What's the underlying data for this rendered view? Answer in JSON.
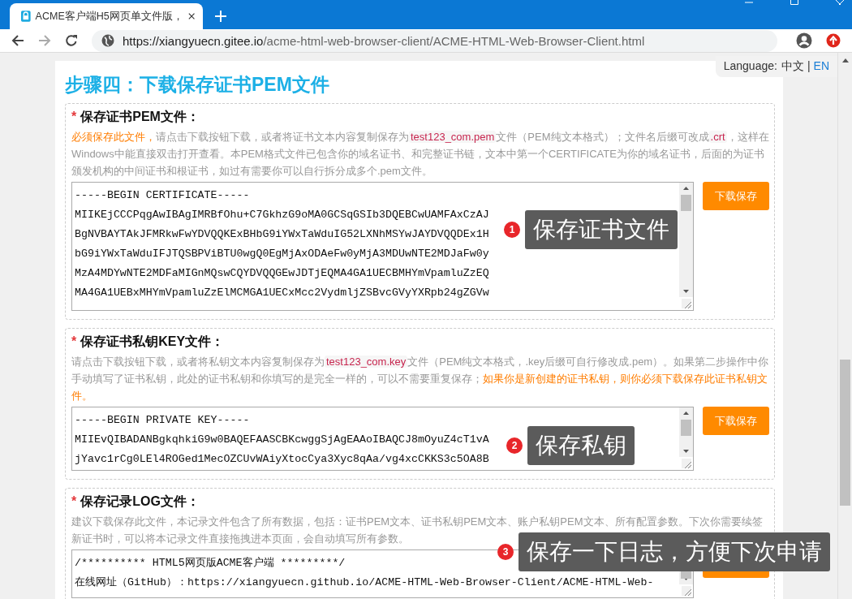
{
  "browser": {
    "tab_title": "ACME客户端H5网页单文件版，",
    "url_host": "https://xiangyuecn.gitee.io",
    "url_path": "/acme-html-web-browser-client/ACME-HTML-Web-Browser-Client.html"
  },
  "language": {
    "label": "Language:",
    "separator": "|",
    "options": [
      {
        "label": "中文",
        "selected": true
      },
      {
        "label": "EN",
        "selected": false
      }
    ]
  },
  "heading": "步骤四：下载保存证书PEM文件",
  "sections": [
    {
      "required_mark": "*",
      "title": "保存证书PEM文件：",
      "description": [
        {
          "kind": "highlight",
          "text": "必须保存此文件，"
        },
        {
          "kind": "text",
          "text": "请点击下载按钮下载，或者将证书文本内容复制保存为"
        },
        {
          "kind": "code",
          "text": "test123_com.pem"
        },
        {
          "kind": "text",
          "text": "文件（PEM纯文本格式）；文件名后缀可改成"
        },
        {
          "kind": "code",
          "text": ".crt"
        },
        {
          "kind": "text",
          "text": "，这样在Windows中能直接双击打开查看。本PEM格式文件已包含你的域名证书、和完整证书链，文本中第一个CERTIFICATE为你的域名证书，后面的为证书颁发机构的中间证书和根证书，如过有需要你可以自行拆分成多个.pem文件。"
        }
      ],
      "code_lines": [
        "-----BEGIN CERTIFICATE-----",
        "MIIKEjCCCPqgAwIBAgIMRBfOhu+C7GkhzG9oMA0GCSqGSIb3DQEBCwUAMFAxCzAJ",
        "BgNVBAYTAkJFMRkwFwYDVQQKExBHbG9iYWxTaWduIG52LXNhMSYwJAYDVQQDEx1H",
        "bG9iYWxTaWduIFJTQSBPViBTU0wgQ0EgMjAxODAeFw0yMjA3MDUwNTE2MDJaFw0y",
        "MzA4MDYwNTE2MDFaMIGnMQswCQYDVQQGEwJDTjEQMA4GA1UECBMHYmVpamluZzEQ",
        "MA4GA1UEBxMHYmVpamluZzElMCMGA1UECxMcc2VydmljZSBvcGVyYXRpb24gZGVw"
      ],
      "button": "下载保存",
      "callout": {
        "number": "1",
        "text": "保存证书文件"
      }
    },
    {
      "required_mark": "*",
      "title": "保存证书私钥KEY文件：",
      "description": [
        {
          "kind": "text",
          "text": "请点击下载按钮下载，或者将私钥文本内容复制保存为"
        },
        {
          "kind": "code",
          "text": "test123_com.key"
        },
        {
          "kind": "text",
          "text": "文件（PEM纯文本格式，.key后缀可自行修改成.pem）。如果第二步操作中你手动填写了证书私钥，此处的证书私钥和你填写的是完全一样的，可以不需要重复保存；"
        },
        {
          "kind": "highlight",
          "text": "如果你是新创建的证书私钥，则你必须下载保存此证书私钥文件。"
        }
      ],
      "code_lines": [
        "-----BEGIN PRIVATE KEY-----",
        "MIIEvQIBADANBgkqhkiG9w0BAQEFAASCBKcwggSjAgEAAoIBAQCJ8mOyuZ4cT1vA",
        "jYavc1rCg0LEl4ROGed1MecOZCUvWAiyXtocCya3Xyc8qAa/vg4xcCKKS3c5OA8B"
      ],
      "button": "下载保存",
      "callout": {
        "number": "2",
        "text": "保存私钥"
      }
    },
    {
      "required_mark": "*",
      "title": "保存记录LOG文件：",
      "description": [
        {
          "kind": "text",
          "text": "建议下载保存此文件，本记录文件包含了所有数据，包括：证书PEM文本、证书私钥PEM文本、账户私钥PEM文本、所有配置参数。下次你需要续签新证书时，可以将本记录文件直接拖拽进本页面，会自动填写所有参数。"
        }
      ],
      "code_lines": [
        "/********** HTML5网页版ACME客户端 *********/",
        "在线网址（GitHub）：https://xiangyuecn.github.io/ACME-HTML-Web-Browser-Client/ACME-HTML-Web-"
      ],
      "callout": {
        "number": "3",
        "text": "保存一下日志，方便下次申请"
      }
    }
  ]
}
